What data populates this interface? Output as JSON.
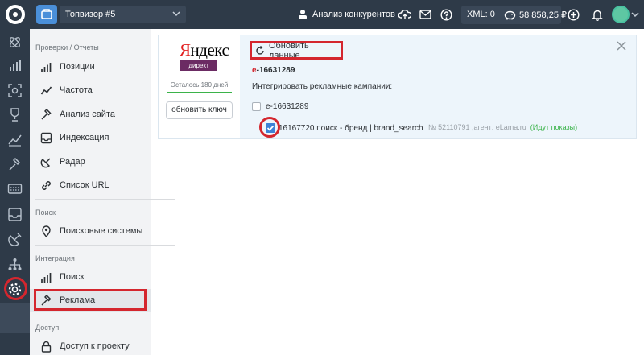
{
  "topbar": {
    "project_name": "Топвизор #5",
    "competitors_label": "Анализ конкурентов",
    "xml_label": "XML: 0",
    "balance": "58 858,25 ₽"
  },
  "rail_icons": [
    "atom-icon",
    "bar-chart-icon",
    "scan-icon",
    "trophy-icon",
    "trend-icon",
    "hammer-icon",
    "keyboard-icon",
    "inbox-icon",
    "satellite-icon",
    "hierarchy-icon",
    "gear-icon"
  ],
  "menu": {
    "section_reports": "Проверки / Отчеты",
    "item_positions": "Позиции",
    "item_frequency": "Частота",
    "item_site_analysis": "Анализ сайта",
    "item_indexing": "Индексация",
    "item_radar": "Радар",
    "item_url_list": "Список URL",
    "section_search": "Поиск",
    "item_search_engines": "Поисковые системы",
    "section_integration": "Интеграция",
    "item_search": "Поиск",
    "item_ads": "Реклама",
    "section_access": "Доступ",
    "item_project_access": "Доступ к проекту"
  },
  "card": {
    "logo_title_first": "Я",
    "logo_title_rest": "ндекс",
    "logo_badge": "директ",
    "remaining": "Осталось 180 дней",
    "refresh_key": "обновить ключ",
    "update_data": "Обновить данные",
    "account_prefix": "e",
    "account_rest": "-16631289",
    "integrate_label": "Интегрировать рекламные кампании:",
    "account_checkbox_label": "e-16631289",
    "campaign_label": "16167720 поиск - бренд | brand_search",
    "campaign_meta": "№ 52110791 ,агент: eLama.ru",
    "campaign_status": "(Идут показы)"
  },
  "colors": {
    "topbar": "#2e3a48",
    "highlight_red": "#d4262e",
    "check_blue": "#3d82d6",
    "status_green": "#3bb34a"
  }
}
